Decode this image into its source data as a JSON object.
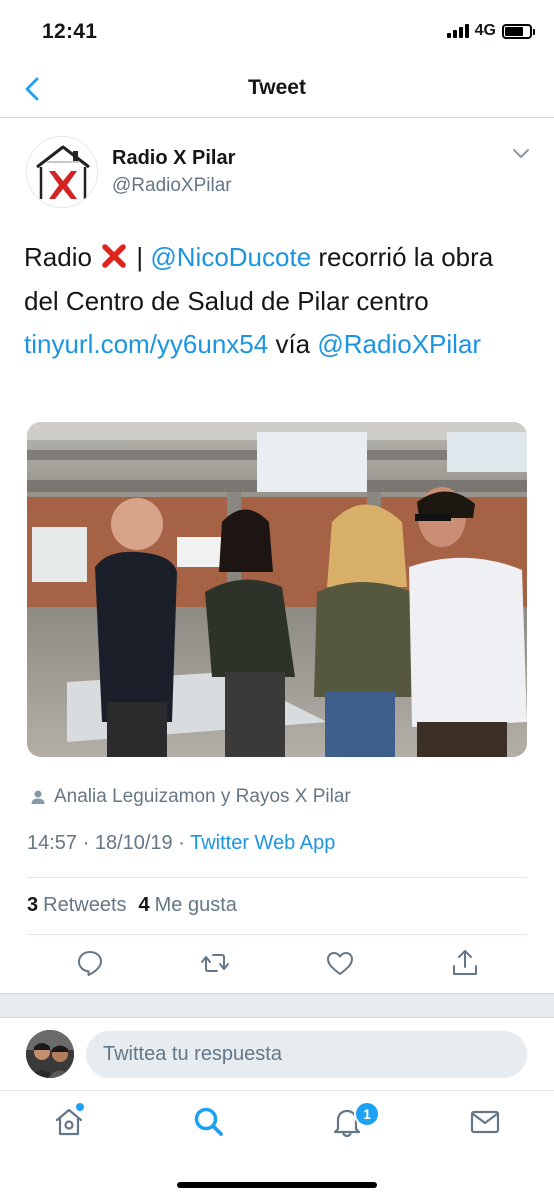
{
  "status_bar": {
    "time": "12:41",
    "network": "4G",
    "battery_level": 0.75
  },
  "nav": {
    "title": "Tweet"
  },
  "tweet": {
    "display_name": "Radio X Pilar",
    "handle": "@RadioXPilar",
    "text": {
      "part1": "Radio",
      "part2": " | ",
      "mention1": "@NicoDucote",
      "part3": " recorrió la obra del Centro de Salud de Pilar centro ",
      "url": "tinyurl.com/yy6unx54",
      "part4": " vía ",
      "mention2": "@RadioXPilar"
    },
    "tagged": "Analia Leguizamon y Rayos X Pilar",
    "timestamp": "14:57 · 18/10/19 · ",
    "source": "Twitter Web App",
    "retweets_count": "3",
    "retweets_label": "Retweets",
    "likes_count": "4",
    "likes_label": "Me gusta"
  },
  "reply": {
    "placeholder": "Twittea tu respuesta"
  },
  "tabs": {
    "notifications_badge": "1"
  },
  "colors": {
    "link": "#1b95e0",
    "accent": "#1da1f2",
    "secondary": "#657786"
  }
}
